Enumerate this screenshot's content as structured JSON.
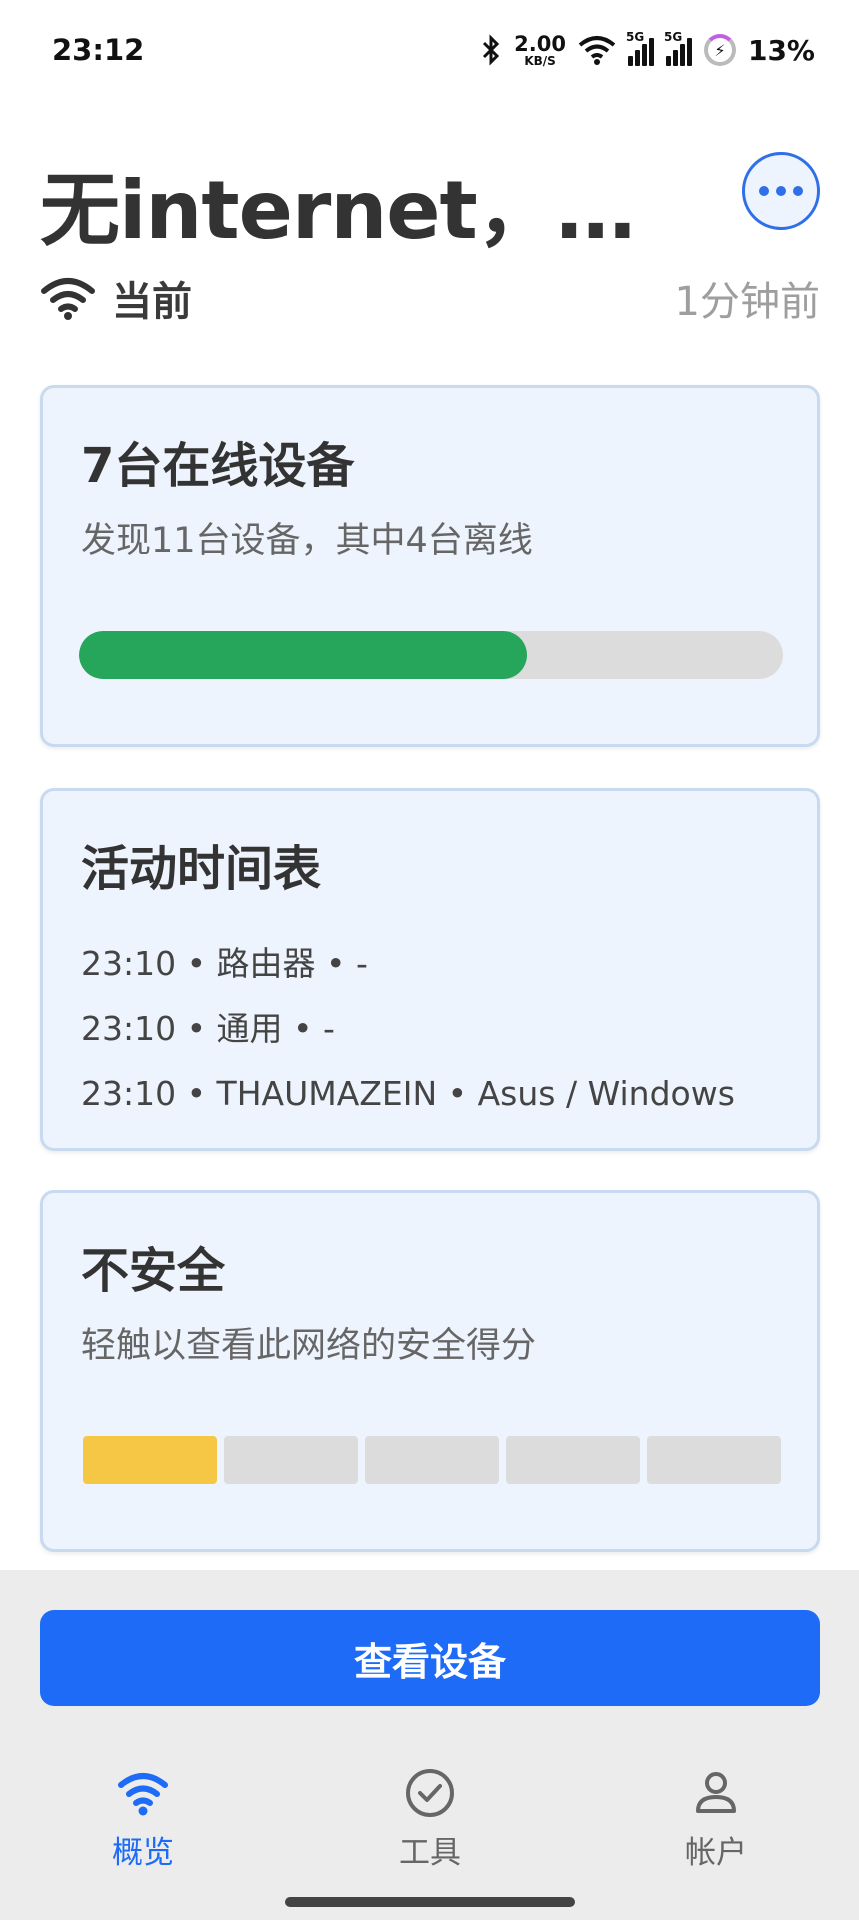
{
  "status_bar": {
    "time": "23:12",
    "speed_value": "2.00",
    "speed_unit": "KB/S",
    "network_type_1": "5G",
    "network_type_2": "5G",
    "battery": "13%"
  },
  "header": {
    "title": "无internet，不安全",
    "network_label": "当前",
    "last_updated": "1分钟前"
  },
  "devices_card": {
    "title": "7台在线设备",
    "subtitle": "发现11台设备，其中4台离线",
    "online_fraction": 0.636,
    "bar_color": "#26a65b"
  },
  "activity_card": {
    "title": "活动时间表",
    "entries": [
      "23:10 • 路由器 • -",
      "23:10 • 通用 • -",
      "23:10 • THAUMAZEIN • Asus / Windows"
    ]
  },
  "security_card": {
    "title": "不安全",
    "subtitle": "轻触以查看此网络的安全得分",
    "score_segments_total": 5,
    "score_segments_filled": 1,
    "score_color": "#f5c744"
  },
  "primary_button": {
    "label": "查看设备"
  },
  "bottom_nav": {
    "items": [
      {
        "label": "概览",
        "icon": "wifi-icon",
        "active": true
      },
      {
        "label": "工具",
        "icon": "check-circle-icon",
        "active": false
      },
      {
        "label": "帐户",
        "icon": "person-icon",
        "active": false
      }
    ]
  },
  "colors": {
    "accent": "#1d6bf6",
    "card_bg": "#eef4fd",
    "card_border": "#c8daf0"
  }
}
